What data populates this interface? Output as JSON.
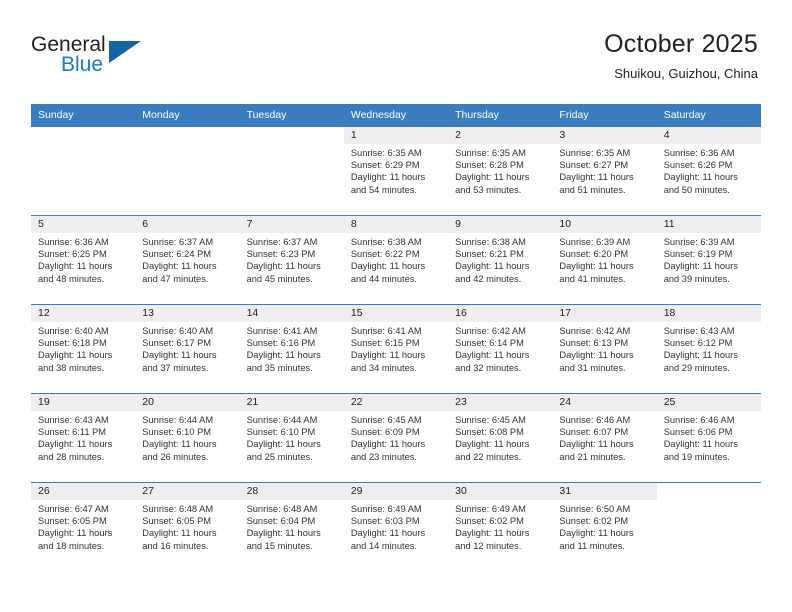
{
  "logo": {
    "word_top": "General",
    "word_bottom": "Blue",
    "triangle_color": "#1464a5",
    "blue_text_color": "#1a7bc4"
  },
  "header": {
    "title": "October 2025",
    "subtitle": "Shuikou, Guizhou, China"
  },
  "theme": {
    "header_band": "#3a7dbe",
    "daynum_band": "#eeeeee",
    "grid_line": "#3a7dbe"
  },
  "weekday_headers": [
    "Sunday",
    "Monday",
    "Tuesday",
    "Wednesday",
    "Thursday",
    "Friday",
    "Saturday"
  ],
  "weeks": [
    [
      {
        "day": "",
        "sunrise": "",
        "sunset": "",
        "daylight1": "",
        "daylight2": ""
      },
      {
        "day": "",
        "sunrise": "",
        "sunset": "",
        "daylight1": "",
        "daylight2": ""
      },
      {
        "day": "",
        "sunrise": "",
        "sunset": "",
        "daylight1": "",
        "daylight2": ""
      },
      {
        "day": "1",
        "sunrise": "Sunrise: 6:35 AM",
        "sunset": "Sunset: 6:29 PM",
        "daylight1": "Daylight: 11 hours",
        "daylight2": "and 54 minutes."
      },
      {
        "day": "2",
        "sunrise": "Sunrise: 6:35 AM",
        "sunset": "Sunset: 6:28 PM",
        "daylight1": "Daylight: 11 hours",
        "daylight2": "and 53 minutes."
      },
      {
        "day": "3",
        "sunrise": "Sunrise: 6:35 AM",
        "sunset": "Sunset: 6:27 PM",
        "daylight1": "Daylight: 11 hours",
        "daylight2": "and 51 minutes."
      },
      {
        "day": "4",
        "sunrise": "Sunrise: 6:36 AM",
        "sunset": "Sunset: 6:26 PM",
        "daylight1": "Daylight: 11 hours",
        "daylight2": "and 50 minutes."
      }
    ],
    [
      {
        "day": "5",
        "sunrise": "Sunrise: 6:36 AM",
        "sunset": "Sunset: 6:25 PM",
        "daylight1": "Daylight: 11 hours",
        "daylight2": "and 48 minutes."
      },
      {
        "day": "6",
        "sunrise": "Sunrise: 6:37 AM",
        "sunset": "Sunset: 6:24 PM",
        "daylight1": "Daylight: 11 hours",
        "daylight2": "and 47 minutes."
      },
      {
        "day": "7",
        "sunrise": "Sunrise: 6:37 AM",
        "sunset": "Sunset: 6:23 PM",
        "daylight1": "Daylight: 11 hours",
        "daylight2": "and 45 minutes."
      },
      {
        "day": "8",
        "sunrise": "Sunrise: 6:38 AM",
        "sunset": "Sunset: 6:22 PM",
        "daylight1": "Daylight: 11 hours",
        "daylight2": "and 44 minutes."
      },
      {
        "day": "9",
        "sunrise": "Sunrise: 6:38 AM",
        "sunset": "Sunset: 6:21 PM",
        "daylight1": "Daylight: 11 hours",
        "daylight2": "and 42 minutes."
      },
      {
        "day": "10",
        "sunrise": "Sunrise: 6:39 AM",
        "sunset": "Sunset: 6:20 PM",
        "daylight1": "Daylight: 11 hours",
        "daylight2": "and 41 minutes."
      },
      {
        "day": "11",
        "sunrise": "Sunrise: 6:39 AM",
        "sunset": "Sunset: 6:19 PM",
        "daylight1": "Daylight: 11 hours",
        "daylight2": "and 39 minutes."
      }
    ],
    [
      {
        "day": "12",
        "sunrise": "Sunrise: 6:40 AM",
        "sunset": "Sunset: 6:18 PM",
        "daylight1": "Daylight: 11 hours",
        "daylight2": "and 38 minutes."
      },
      {
        "day": "13",
        "sunrise": "Sunrise: 6:40 AM",
        "sunset": "Sunset: 6:17 PM",
        "daylight1": "Daylight: 11 hours",
        "daylight2": "and 37 minutes."
      },
      {
        "day": "14",
        "sunrise": "Sunrise: 6:41 AM",
        "sunset": "Sunset: 6:16 PM",
        "daylight1": "Daylight: 11 hours",
        "daylight2": "and 35 minutes."
      },
      {
        "day": "15",
        "sunrise": "Sunrise: 6:41 AM",
        "sunset": "Sunset: 6:15 PM",
        "daylight1": "Daylight: 11 hours",
        "daylight2": "and 34 minutes."
      },
      {
        "day": "16",
        "sunrise": "Sunrise: 6:42 AM",
        "sunset": "Sunset: 6:14 PM",
        "daylight1": "Daylight: 11 hours",
        "daylight2": "and 32 minutes."
      },
      {
        "day": "17",
        "sunrise": "Sunrise: 6:42 AM",
        "sunset": "Sunset: 6:13 PM",
        "daylight1": "Daylight: 11 hours",
        "daylight2": "and 31 minutes."
      },
      {
        "day": "18",
        "sunrise": "Sunrise: 6:43 AM",
        "sunset": "Sunset: 6:12 PM",
        "daylight1": "Daylight: 11 hours",
        "daylight2": "and 29 minutes."
      }
    ],
    [
      {
        "day": "19",
        "sunrise": "Sunrise: 6:43 AM",
        "sunset": "Sunset: 6:11 PM",
        "daylight1": "Daylight: 11 hours",
        "daylight2": "and 28 minutes."
      },
      {
        "day": "20",
        "sunrise": "Sunrise: 6:44 AM",
        "sunset": "Sunset: 6:10 PM",
        "daylight1": "Daylight: 11 hours",
        "daylight2": "and 26 minutes."
      },
      {
        "day": "21",
        "sunrise": "Sunrise: 6:44 AM",
        "sunset": "Sunset: 6:10 PM",
        "daylight1": "Daylight: 11 hours",
        "daylight2": "and 25 minutes."
      },
      {
        "day": "22",
        "sunrise": "Sunrise: 6:45 AM",
        "sunset": "Sunset: 6:09 PM",
        "daylight1": "Daylight: 11 hours",
        "daylight2": "and 23 minutes."
      },
      {
        "day": "23",
        "sunrise": "Sunrise: 6:45 AM",
        "sunset": "Sunset: 6:08 PM",
        "daylight1": "Daylight: 11 hours",
        "daylight2": "and 22 minutes."
      },
      {
        "day": "24",
        "sunrise": "Sunrise: 6:46 AM",
        "sunset": "Sunset: 6:07 PM",
        "daylight1": "Daylight: 11 hours",
        "daylight2": "and 21 minutes."
      },
      {
        "day": "25",
        "sunrise": "Sunrise: 6:46 AM",
        "sunset": "Sunset: 6:06 PM",
        "daylight1": "Daylight: 11 hours",
        "daylight2": "and 19 minutes."
      }
    ],
    [
      {
        "day": "26",
        "sunrise": "Sunrise: 6:47 AM",
        "sunset": "Sunset: 6:05 PM",
        "daylight1": "Daylight: 11 hours",
        "daylight2": "and 18 minutes."
      },
      {
        "day": "27",
        "sunrise": "Sunrise: 6:48 AM",
        "sunset": "Sunset: 6:05 PM",
        "daylight1": "Daylight: 11 hours",
        "daylight2": "and 16 minutes."
      },
      {
        "day": "28",
        "sunrise": "Sunrise: 6:48 AM",
        "sunset": "Sunset: 6:04 PM",
        "daylight1": "Daylight: 11 hours",
        "daylight2": "and 15 minutes."
      },
      {
        "day": "29",
        "sunrise": "Sunrise: 6:49 AM",
        "sunset": "Sunset: 6:03 PM",
        "daylight1": "Daylight: 11 hours",
        "daylight2": "and 14 minutes."
      },
      {
        "day": "30",
        "sunrise": "Sunrise: 6:49 AM",
        "sunset": "Sunset: 6:02 PM",
        "daylight1": "Daylight: 11 hours",
        "daylight2": "and 12 minutes."
      },
      {
        "day": "31",
        "sunrise": "Sunrise: 6:50 AM",
        "sunset": "Sunset: 6:02 PM",
        "daylight1": "Daylight: 11 hours",
        "daylight2": "and 11 minutes."
      },
      {
        "day": "",
        "sunrise": "",
        "sunset": "",
        "daylight1": "",
        "daylight2": ""
      }
    ]
  ]
}
